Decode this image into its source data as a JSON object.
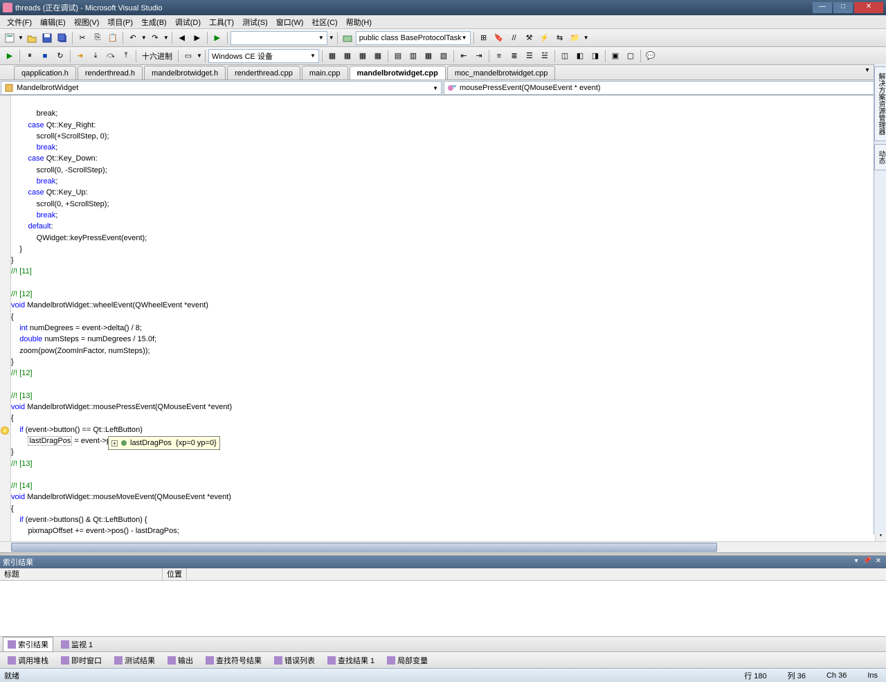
{
  "title": "threads (正在调试) - Microsoft Visual Studio",
  "menus": [
    "文件(F)",
    "编辑(E)",
    "视图(V)",
    "项目(P)",
    "生成(B)",
    "调试(D)",
    "工具(T)",
    "测试(S)",
    "窗口(W)",
    "社区(C)",
    "帮助(H)"
  ],
  "toolbar1": {
    "combo_scope": "public class BaseProtocolTask"
  },
  "toolbar2": {
    "hex_label": "十六进制",
    "platform": "Windows CE 设备"
  },
  "tabs": [
    "qapplication.h",
    "renderthread.h",
    "mandelbrotwidget.h",
    "renderthread.cpp",
    "main.cpp",
    "mandelbrotwidget.cpp",
    "moc_mandelbrotwidget.cpp"
  ],
  "active_tab": 5,
  "nav_left": "MandelbrotWidget",
  "nav_right": "mousePressEvent(QMouseEvent * event)",
  "debug_tooltip": "lastDragPos  {xp=0 yp=0}",
  "index_panel": {
    "title": "索引结果",
    "col1": "标题",
    "col2": "位置"
  },
  "bottom_tabs": [
    "索引结果",
    "监视 1"
  ],
  "status_tabs": [
    "调用堆栈",
    "即时窗口",
    "测试结果",
    "输出",
    "查找符号结果",
    "错误列表",
    "查找结果 1",
    "局部变量"
  ],
  "statusbar": {
    "ready": "就绪",
    "line": "行 180",
    "col": "列 36",
    "ch": "Ch 36",
    "ins": "Ins"
  },
  "side_tabs": [
    "解决方案资源管理器",
    "动态"
  ],
  "code": {
    "l01": "            break;",
    "l02": "        case Qt::Key_Right:",
    "l03": "            scroll(+ScrollStep, 0);",
    "l04": "            break;",
    "l05": "        case Qt::Key_Down:",
    "l06": "            scroll(0, -ScrollStep);",
    "l07": "            break;",
    "l08": "        case Qt::Key_Up:",
    "l09": "            scroll(0, +ScrollStep);",
    "l10": "            break;",
    "l11": "        default:",
    "l12": "            QWidget::keyPressEvent(event);",
    "l13": "    }",
    "l14": "}",
    "l15": "//! [11]",
    "l16": "",
    "l17": "//! [12]",
    "l18a": "void",
    "l18b": " MandelbrotWidget::wheelEvent(QWheelEvent *event)",
    "l19": "{",
    "l20a": "    int",
    "l20b": " numDegrees = event->delta() / 8;",
    "l21a": "    double",
    "l21b": " numSteps = numDegrees / 15.0f;",
    "l22": "    zoom(pow(ZoomInFactor, numSteps));",
    "l23": "}",
    "l24": "//! [12]",
    "l25": "",
    "l26": "//! [13]",
    "l27a": "void",
    "l27b": " MandelbrotWidget::mousePressEvent(QMouseEvent *event)",
    "l28": "{",
    "l29a": "    if",
    "l29b": " (event->button() == Qt::LeftButton)",
    "l30a": "        ",
    "l30b": "lastDragPos",
    "l30c": " = event->pos();",
    "l31": "}",
    "l32": "//! [13]",
    "l33": "",
    "l34": "//! [14]",
    "l35a": "void",
    "l35b": " MandelbrotWidget::mouseMoveEvent(QMouseEvent *event)",
    "l36": "{",
    "l37a": "    if",
    "l37b": " (event->buttons() & Qt::LeftButton) {",
    "l38": "        pixmapOffset += event->pos() - lastDragPos;"
  }
}
